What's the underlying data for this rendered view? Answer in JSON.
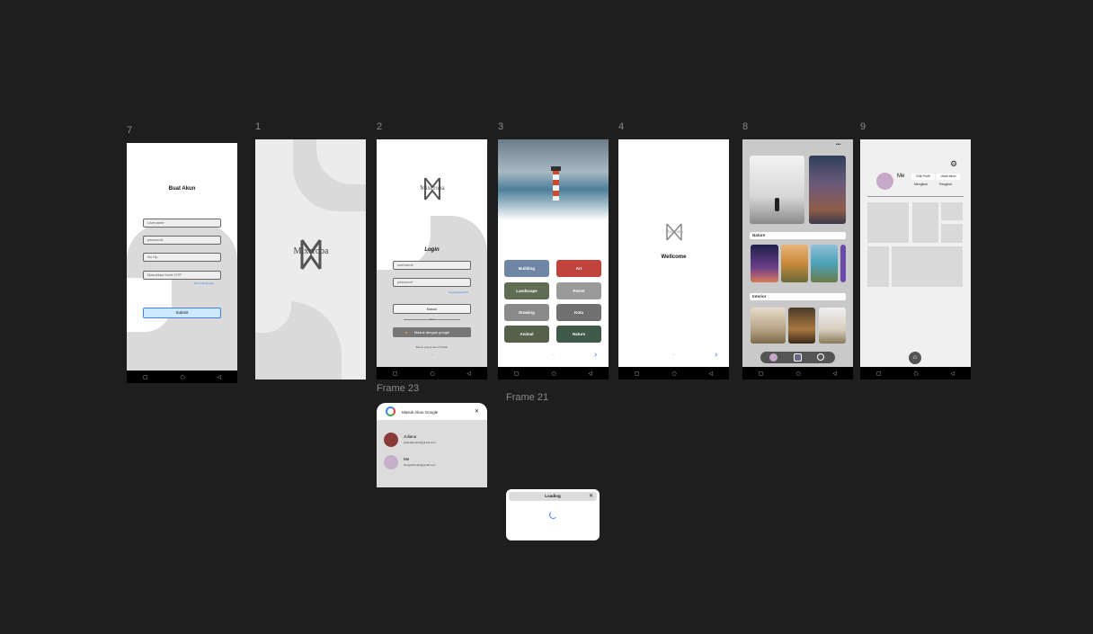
{
  "frames": {
    "f7": {
      "label": "7",
      "title": "Buat Akun",
      "username": "Username",
      "password": "password",
      "phone": "No Hp",
      "otp": "Masukkan Kode OTP",
      "resend": "kirim ulang kode",
      "submit": "Submit"
    },
    "f1": {
      "label": "1",
      "logo": "Mixcroba"
    },
    "f2": {
      "label": "2",
      "logo": "Mixcroba",
      "title": "Login",
      "username": "username",
      "password": "password",
      "forgot": "Lupa password?",
      "login": "Masuk",
      "or": "atau",
      "google": "Masuk dengan google",
      "register": "Belum punya akun? Daftar",
      "dots": "..."
    },
    "f3": {
      "label": "3",
      "tiles": [
        "Building",
        "Art",
        "Landscape",
        "Potret",
        "Drawing",
        "Kota",
        "Animal",
        "Nature"
      ],
      "dots": "...",
      "next": "›"
    },
    "f4": {
      "label": "4",
      "logo": "Mixcroba",
      "welcome": "Wellcome",
      "dots": "...",
      "next": "›"
    },
    "f8": {
      "label": "8",
      "menu": "•••",
      "nature": "Nature",
      "interior": "Interior"
    },
    "f9": {
      "label": "9",
      "name": "Me",
      "edit": "Edit Profil",
      "share": "Ubah Akun",
      "followers": "Mengikuti",
      "following": "Pengikut"
    },
    "f23": {
      "label": "Frame 23",
      "title": "Masuk Akun Google",
      "close": "✕",
      "accounts": [
        {
          "name": "Juliana",
          "email": "julianaberanta@gmail.com"
        },
        {
          "name": "Me",
          "email": "Googlefriends@gmail.com"
        }
      ]
    },
    "f21": {
      "label": "Frame 21",
      "title": "Loading",
      "close": "✕"
    }
  },
  "navbar": {
    "square": "▢",
    "circle": "○",
    "back": "◁"
  }
}
